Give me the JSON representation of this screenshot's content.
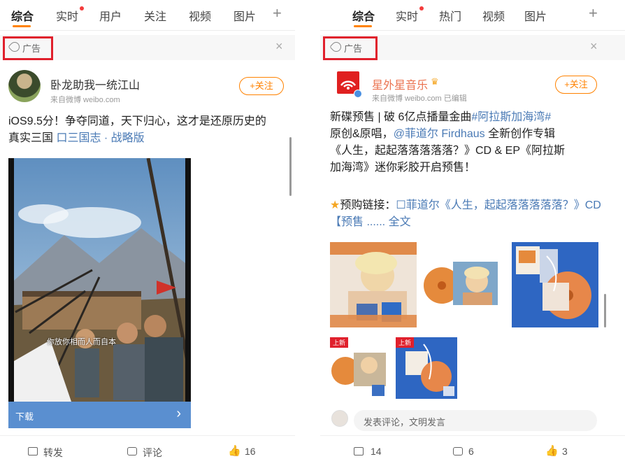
{
  "left": {
    "tabs": [
      "综合",
      "实时",
      "用户",
      "关注",
      "视频",
      "图片"
    ],
    "ad_label": "广告",
    "close_icon": "×",
    "plus_icon": "+",
    "post": {
      "author": "卧龙助我一统江山",
      "source": "来自微博 weibo.com",
      "follow": "+关注",
      "text_prefix": "iOS9.5分！争夺同道，天下归心，这才是还原历史的真实三国 ",
      "text_link": "口三国志 · 战略版",
      "video_caption": "你放你相而人而自本",
      "download": "下载",
      "download_arrow": "›"
    },
    "footer": {
      "repost": "转发",
      "comment": "评论",
      "likes": "16"
    }
  },
  "right": {
    "tabs": [
      "综合",
      "实时",
      "热门",
      "视频",
      "图片"
    ],
    "ad_label": "广告",
    "close_icon": "×",
    "plus_icon": "+",
    "post": {
      "author": "星外星音乐",
      "source": "来自微博 weibo.com  已编辑",
      "follow": "+关注",
      "line1_a": "新碟预售 | 破 6亿点播量金曲",
      "line1_b": "#阿拉斯加海湾#",
      "line2_a": "原创&原唱，",
      "line2_b": "@菲道尔 Firdhaus",
      "line2_c": " 全新创作专辑",
      "line3": "《人生，起起落落落落落？》CD & EP《阿拉斯",
      "line4": "加海湾》迷你彩胶开启预售！",
      "preorder_icon": "★",
      "preorder_label": "预购链接：",
      "preorder_link": "☐菲道尔《人生，起起落落落落落？》CD【预售 ......",
      "full_text": "全文",
      "badge": "上新",
      "comment_placeholder": "发表评论，文明发言"
    },
    "footer": {
      "repost": "14",
      "comment": "6",
      "likes": "3"
    }
  },
  "colors": {
    "accent": "#ff8200",
    "highlight_box": "#e0202c",
    "link": "#4a7ab5"
  }
}
